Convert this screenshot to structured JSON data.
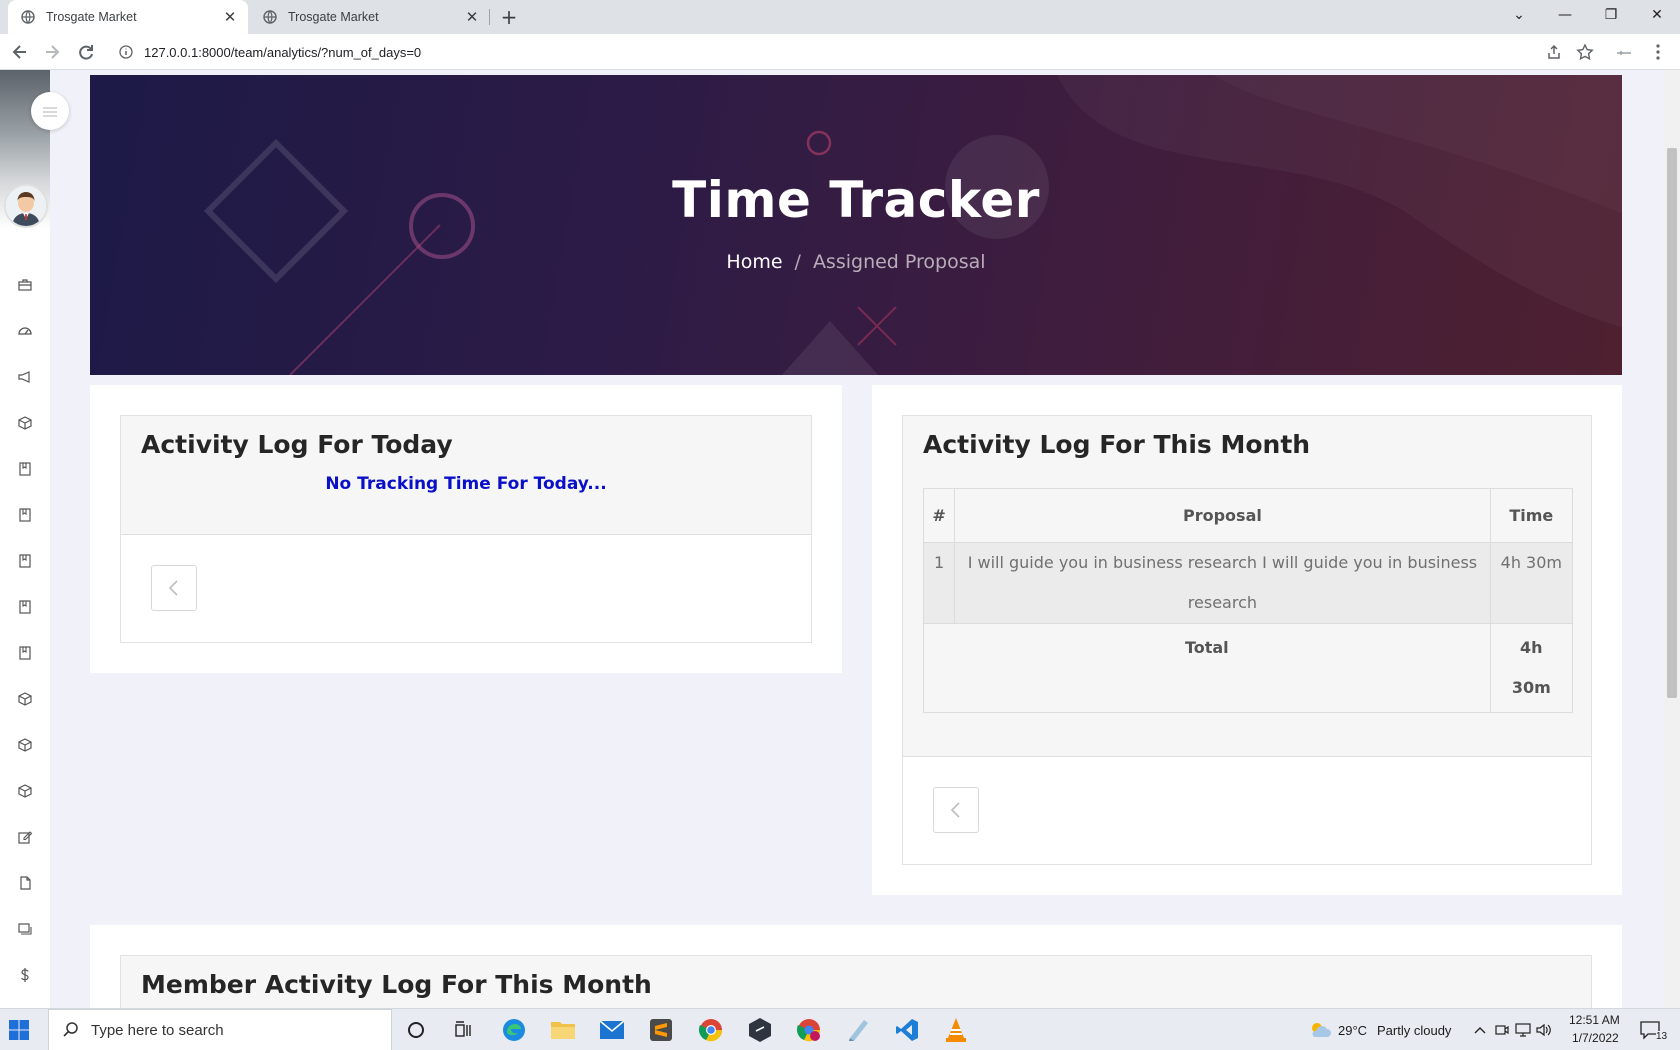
{
  "browser": {
    "tabs": [
      {
        "label": "Trosgate Market",
        "active": true
      },
      {
        "label": "Trosgate Market",
        "active": false
      }
    ],
    "url": "127.0.0.1:8000/team/analytics/?num_of_days=0"
  },
  "banner": {
    "title": "Time Tracker",
    "breadcrumb_home": "Home",
    "breadcrumb_sep": "/",
    "breadcrumb_current": "Assigned Proposal"
  },
  "today_card": {
    "title": "Activity Log For Today",
    "empty_message": "No Tracking Time For Today..."
  },
  "month_card": {
    "title": "Activity Log For This Month",
    "table": {
      "headers": [
        "#",
        "Proposal",
        "Time"
      ],
      "rows": [
        {
          "num": "1",
          "proposal": "I will guide you in business research I will guide you in business research",
          "time": "4h 30m"
        }
      ],
      "total_label": "Total",
      "total_value": "4h 30m"
    }
  },
  "member_card": {
    "title": "Member Activity Log For This Month"
  },
  "taskbar": {
    "search_placeholder": "Type here to search",
    "weather_temp": "29°C",
    "weather_desc": "Partly cloudy",
    "time": "12:51 AM",
    "date": "1/7/2022",
    "notification_count": "13"
  },
  "colors": {
    "banner_start": "#1d1a47",
    "banner_end": "#4e2030",
    "empty_message": "#0a0fc8"
  }
}
